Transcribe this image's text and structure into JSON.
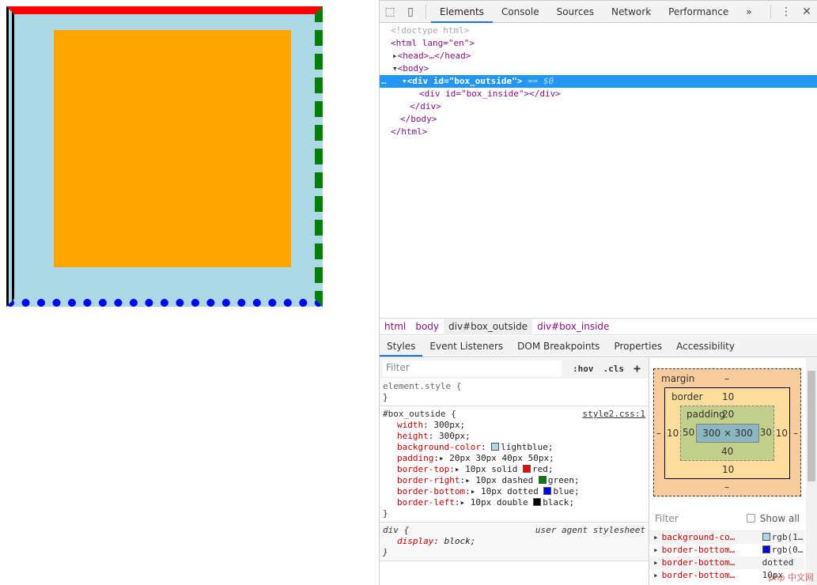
{
  "page": {
    "outer_id": "box_outside",
    "inner_id": "box_inside"
  },
  "toolbar": {
    "tabs": [
      "Elements",
      "Console",
      "Sources",
      "Network",
      "Performance"
    ],
    "more": "»",
    "menu": "⋮",
    "close": "✕"
  },
  "dom": {
    "doctype": "<!doctype html>",
    "html_open": "<html lang=\"en\">",
    "head": "<head>…</head>",
    "body_open": "<body>",
    "div_outside": "<div id=\"box_outside\">",
    "selected_marker": "== $0",
    "div_inside": "<div id=\"box_inside\"></div>",
    "div_close": "</div>",
    "body_close": "</body>",
    "html_close": "</html>"
  },
  "breadcrumbs": [
    "html",
    "body",
    "div#box_outside",
    "div#box_inside"
  ],
  "subtabs": [
    "Styles",
    "Event Listeners",
    "DOM Breakpoints",
    "Properties",
    "Accessibility"
  ],
  "styles": {
    "filter_placeholder": "Filter",
    "hov": ":hov",
    "cls": ".cls",
    "add": "+",
    "element_style": "element.style {",
    "close": "}",
    "rule_selector": "#box_outside {",
    "rule_source": "style2.css:1",
    "props": [
      {
        "name": "width",
        "value": "300px;"
      },
      {
        "name": "height",
        "value": "300px;"
      },
      {
        "name": "background-color",
        "value": "lightblue;",
        "swatch": "#add8e6"
      },
      {
        "name": "padding",
        "value": "20px 30px 40px 50px;"
      },
      {
        "name": "border-top",
        "value": "10px solid",
        "color_value": "red;",
        "swatch": "#ff0000"
      },
      {
        "name": "border-right",
        "value": "10px dashed",
        "color_value": "green;",
        "swatch": "#008000"
      },
      {
        "name": "border-bottom",
        "value": "10px dotted",
        "color_value": "blue;",
        "swatch": "#0000ff"
      },
      {
        "name": "border-left",
        "value": "10px double",
        "color_value": "black;",
        "swatch": "#000000"
      }
    ],
    "ua_selector": "div {",
    "ua_source": "user agent stylesheet",
    "ua_prop": "display",
    "ua_value": "block;"
  },
  "boxmodel": {
    "margin_label": "margin",
    "margin": "–",
    "border_label": "border",
    "border_top": "10",
    "border_bottom": "10",
    "border_left": "10",
    "border_right": "10",
    "padding_label": "padding",
    "padding_top": "20",
    "padding_right": "30",
    "padding_bottom": "40",
    "padding_left": "50",
    "content": "300 × 300",
    "margin_left": "–",
    "margin_right": "–",
    "margin_bottom": "–"
  },
  "computed": {
    "filter_placeholder": "Filter",
    "show_all": "Show all",
    "rows": [
      {
        "name": "background-co…",
        "value": "rgb(1…",
        "swatch": "#add8e6"
      },
      {
        "name": "border-bottom…",
        "value": "rgb(0…",
        "swatch": "#0000ff"
      },
      {
        "name": "border-bottom…",
        "value": "dotted"
      },
      {
        "name": "border-bottom…",
        "value": "10px"
      }
    ]
  },
  "watermark": "php 中文网"
}
